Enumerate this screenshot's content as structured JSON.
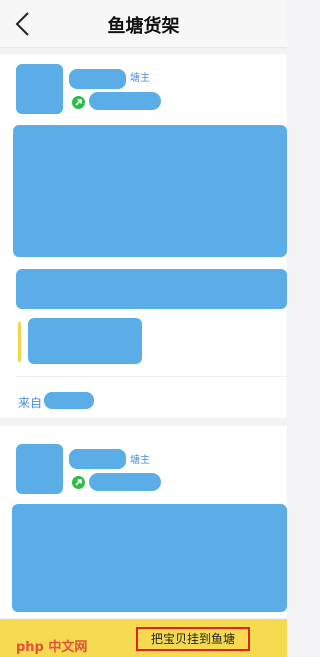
{
  "header": {
    "title": "鱼塘货架",
    "back_icon": "chevron-left-icon"
  },
  "posts": [
    {
      "role_badge": "塘主",
      "source_label": "来自"
    },
    {
      "role_badge": "塘主"
    }
  ],
  "footer": {
    "cta_label": "把宝贝挂到鱼塘",
    "accent_color": "#f5d94e"
  },
  "watermark": {
    "text": "php 中文网"
  },
  "colors": {
    "placeholder": "#5aade6",
    "link": "#4a8fd6",
    "highlight_border": "#dd2222"
  }
}
